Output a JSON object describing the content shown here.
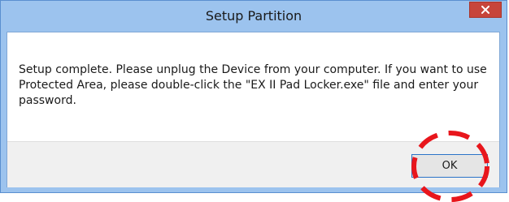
{
  "dialog": {
    "title": "Setup Partition",
    "message": "Setup complete. Please unplug the Device from your computer. If you want to use Protected Area, please double-click the \"EX II Pad Locker.exe\" file and enter your password.",
    "ok_label": "OK"
  },
  "icons": {
    "close": "close-icon",
    "highlight": "dashed-circle-annotation"
  },
  "colors": {
    "frame": "#9cc3ee",
    "close_button": "#c7453b",
    "annotation": "#e8161c",
    "footer": "#f0f0f0"
  }
}
